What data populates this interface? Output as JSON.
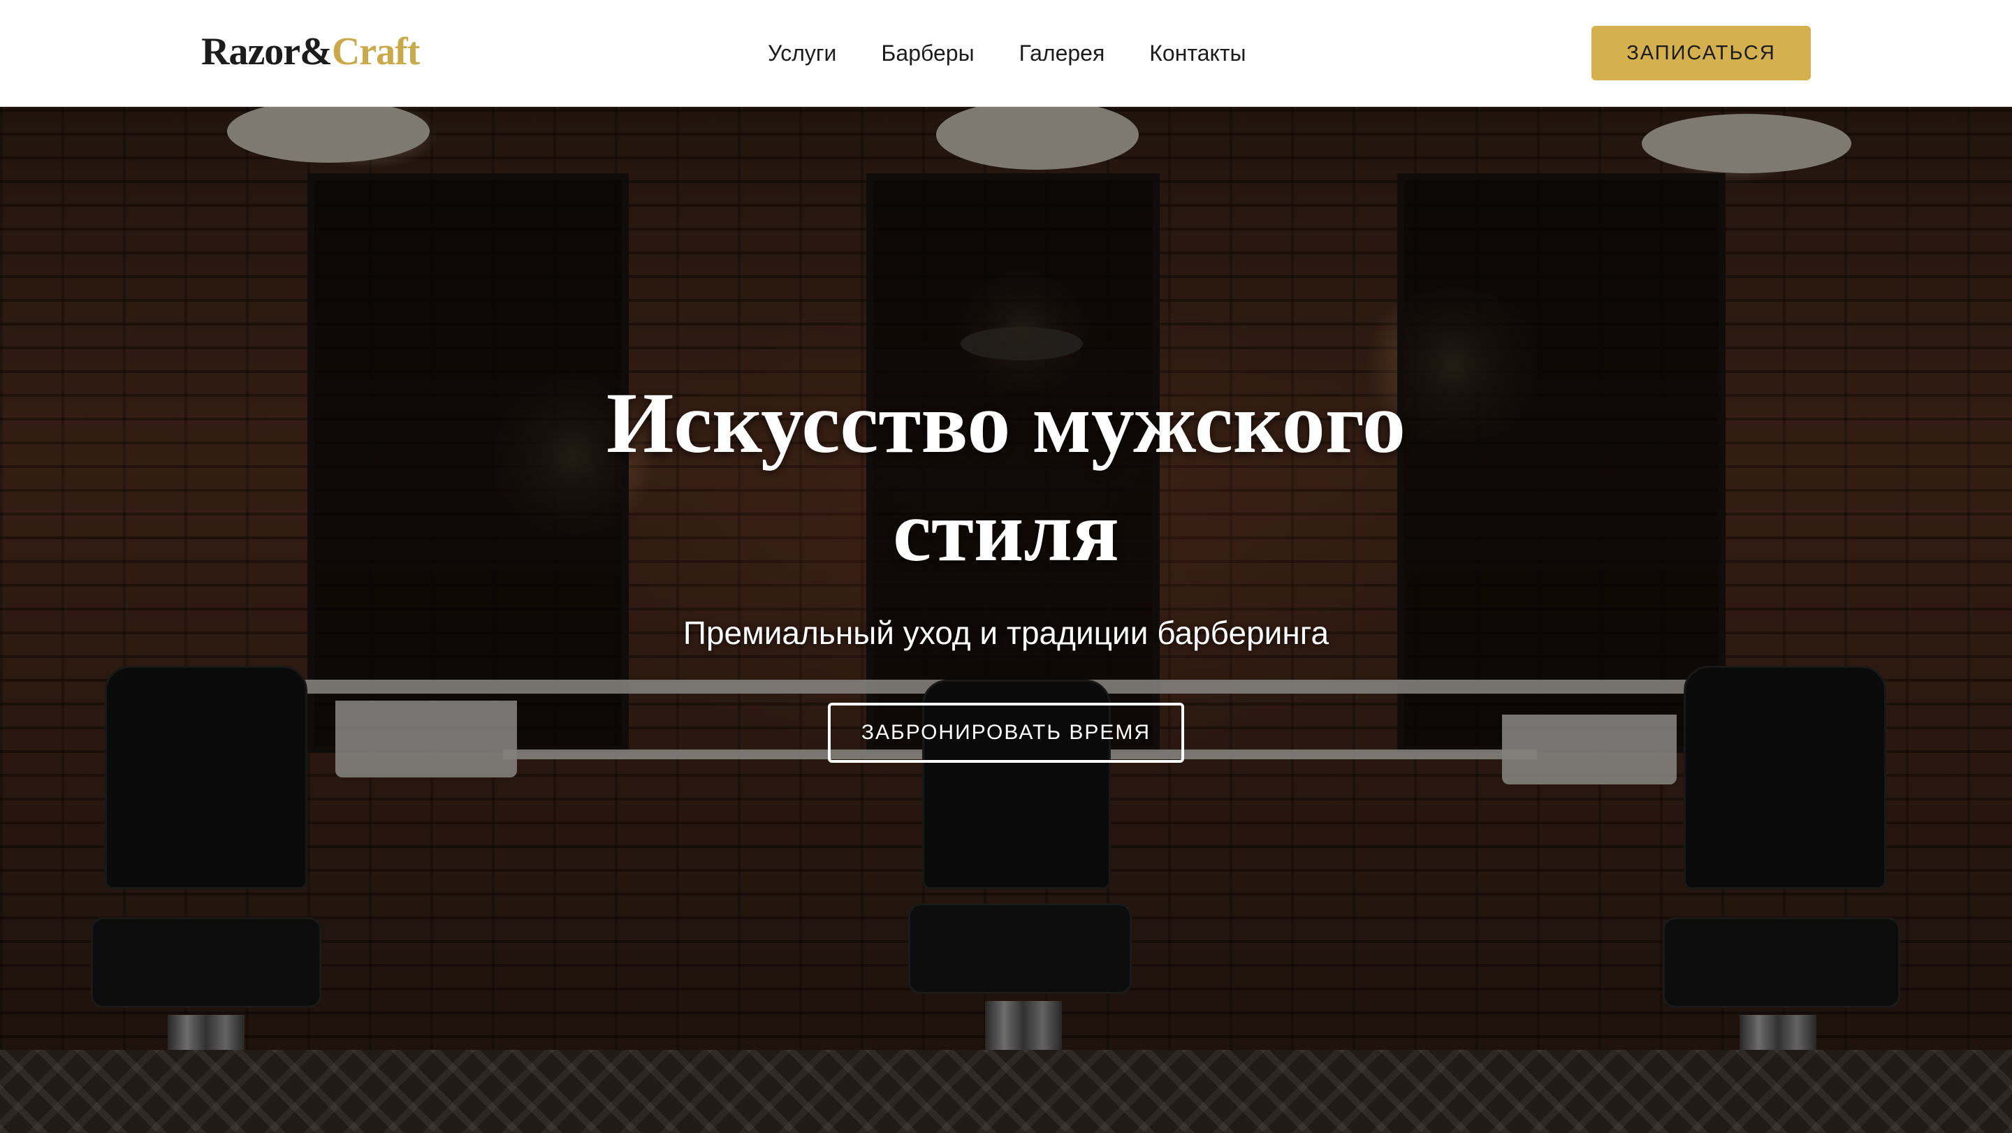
{
  "header": {
    "logo": {
      "part1": "Razor&",
      "part2": "Craft"
    },
    "nav": [
      {
        "label": "Услуги"
      },
      {
        "label": "Барберы"
      },
      {
        "label": "Галерея"
      },
      {
        "label": "Контакты"
      }
    ],
    "cta_label": "ЗАПИСАТЬСЯ"
  },
  "hero": {
    "title": "Искусство мужского стиля",
    "subtitle": "Премиальный уход и традиции барберинга",
    "cta_label": "ЗАБРОНИРОВАТЬ ВРЕМЯ"
  },
  "colors": {
    "accent": "#d4b04f",
    "logo_gold": "#c9a94a",
    "text_dark": "#1c1c1c",
    "hero_text": "#ffffff"
  }
}
